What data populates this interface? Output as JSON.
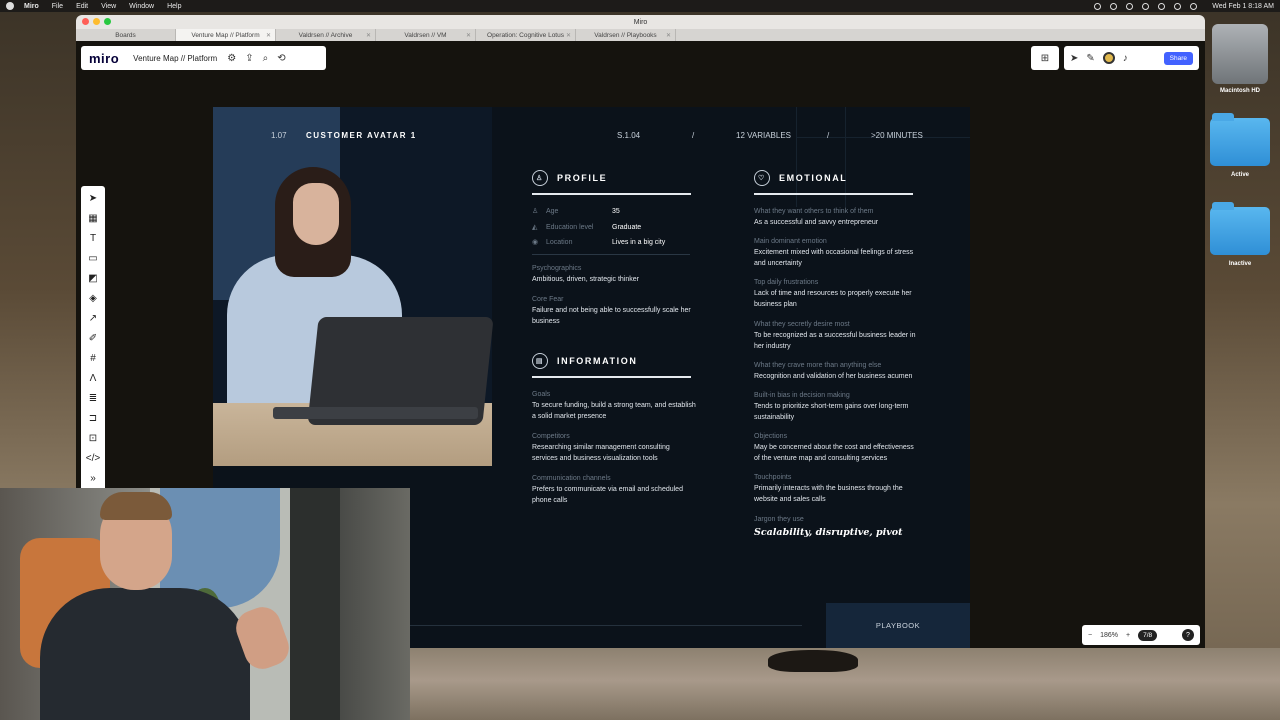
{
  "menubar": {
    "app_name": "Miro",
    "items": [
      "File",
      "Edit",
      "View",
      "Window",
      "Help"
    ],
    "clock": "Wed Feb 1  8:18 AM"
  },
  "window": {
    "title": "Miro",
    "tabs": [
      {
        "label": "Boards",
        "active": false
      },
      {
        "label": "Venture Map // Platform",
        "active": true
      },
      {
        "label": "Valdrsen // Archive",
        "active": false
      },
      {
        "label": "Valdrsen // VM",
        "active": false
      },
      {
        "label": "Operation: Cognitive Lotus",
        "active": false
      },
      {
        "label": "Valdrsen // Playbooks",
        "active": false
      }
    ]
  },
  "miro": {
    "logo": "miro",
    "board_name": "Venture Map // Platform",
    "share_label": "Share",
    "zoom": "186%",
    "frames": "7/8",
    "help": "?"
  },
  "board": {
    "page_num": "1.07",
    "title": "CUSTOMER AVATAR 1",
    "section_code": "S.1.04",
    "sep1": "/",
    "variables": "12 VARIABLES",
    "sep2": "/",
    "duration": ">20 MINUTES",
    "profile": {
      "heading": "PROFILE",
      "rows": [
        {
          "key": "Age",
          "value": "35"
        },
        {
          "key": "Education level",
          "value": "Graduate"
        },
        {
          "key": "Location",
          "value": "Lives in a big city"
        }
      ],
      "blocks": [
        {
          "label": "Psychographics",
          "value": "Ambitious, driven, strategic thinker"
        },
        {
          "label": "Core Fear",
          "value": "Failure and not being able to successfully scale her business"
        }
      ]
    },
    "information": {
      "heading": "INFORMATION",
      "blocks": [
        {
          "label": "Goals",
          "value": "To secure funding, build a strong team, and establish a solid market presence"
        },
        {
          "label": "Competitors",
          "value": "Researching similar management consulting services and business visualization tools"
        },
        {
          "label": "Communication channels",
          "value": "Prefers to communicate via email and scheduled phone calls"
        }
      ]
    },
    "emotional": {
      "heading": "EMOTIONAL",
      "blocks": [
        {
          "label": "What they want others to think of them",
          "value": "As a successful and savvy entrepreneur"
        },
        {
          "label": "Main dominant emotion",
          "value": "Excitement mixed with occasional feelings of stress and uncertainty"
        },
        {
          "label": "Top daily frustrations",
          "value": "Lack of time and resources to properly execute her business plan"
        },
        {
          "label": "What they secretly desire most",
          "value": "To be recognized as a successful business leader in her industry"
        },
        {
          "label": "What they crave more than anything else",
          "value": "Recognition and validation of her business acumen"
        },
        {
          "label": "Built-in bias in decision making",
          "value": "Tends to prioritize short-term gains over long-term sustainability"
        },
        {
          "label": "Objections",
          "value": "May be concerned about the cost and effectiveness of the venture map and consulting services"
        },
        {
          "label": "Touchpoints",
          "value": "Primarily interacts with the business through the website and sales calls"
        }
      ],
      "jargon_label": "Jargon they use",
      "jargon_value": "Scalability, disruptive, pivot"
    },
    "playbook": "PLAYBOOK"
  },
  "desktop": {
    "icons": [
      {
        "label": "Macintosh HD"
      },
      {
        "label": "Active"
      },
      {
        "label": "Inactive"
      }
    ]
  },
  "colors": {
    "board_bg": "#0b121a",
    "share_blue": "#4262ff",
    "accent_block": "#253c58"
  }
}
